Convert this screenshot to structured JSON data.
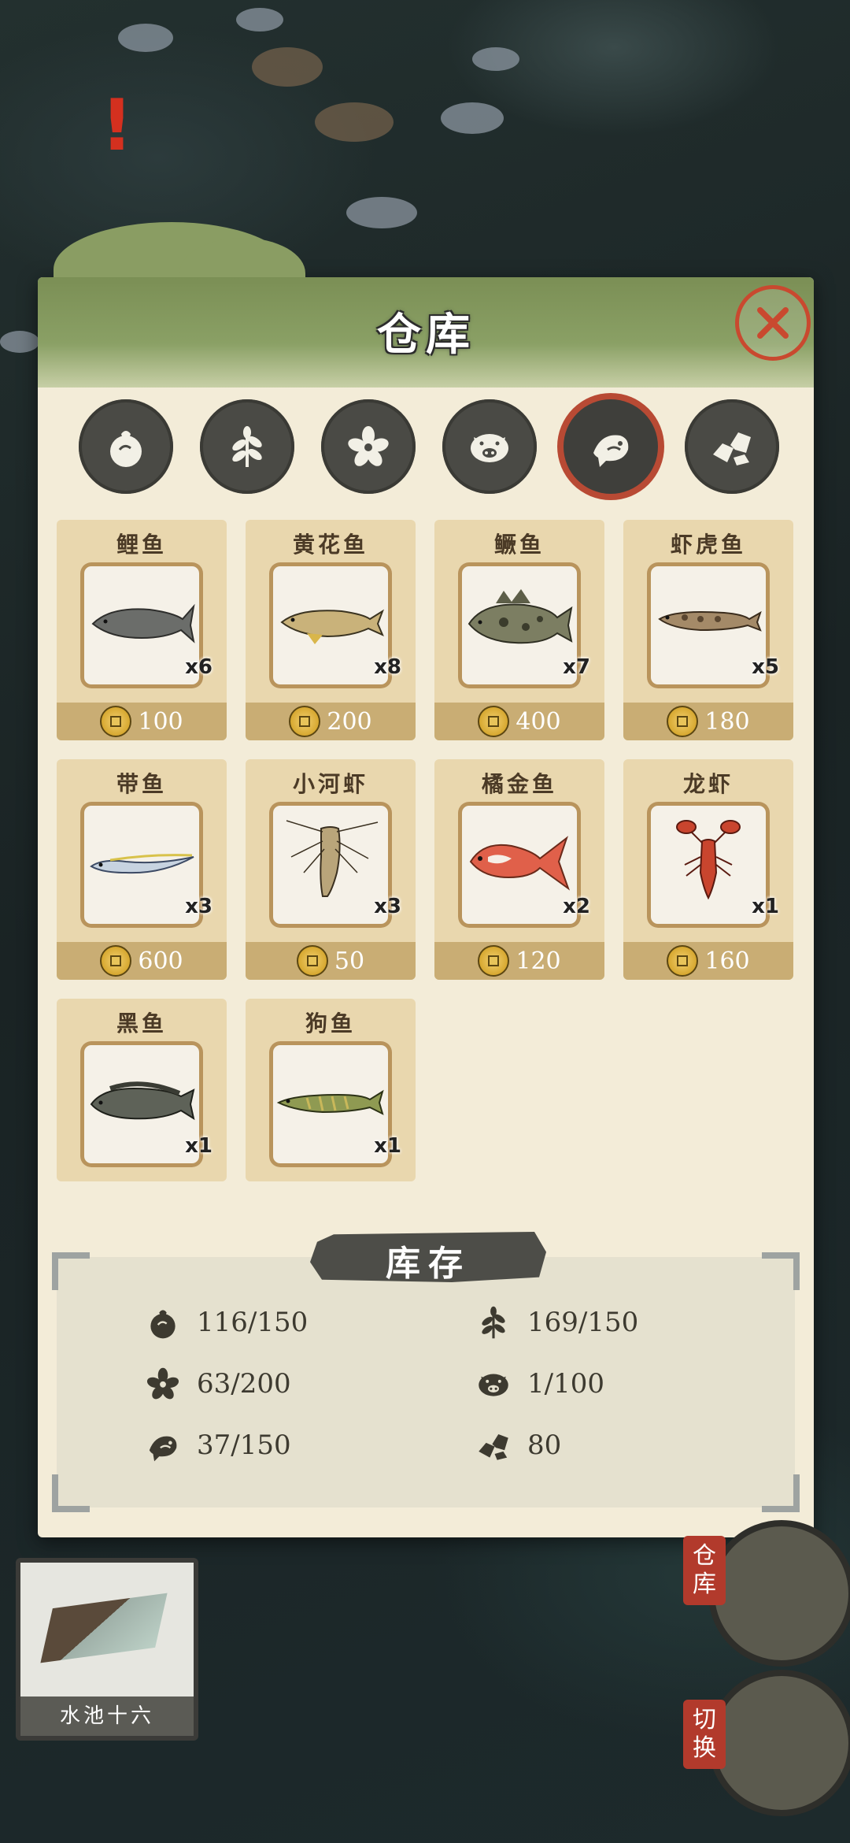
{
  "panel": {
    "title": "仓库"
  },
  "tabs": [
    {
      "icon": "vegetable-icon",
      "active": false
    },
    {
      "icon": "herb-icon",
      "active": false
    },
    {
      "icon": "flower-icon",
      "active": false
    },
    {
      "icon": "pig-icon",
      "active": false
    },
    {
      "icon": "fish-icon",
      "active": true
    },
    {
      "icon": "ore-icon",
      "active": false
    }
  ],
  "items": [
    {
      "name": "鲤鱼",
      "qty": "x6",
      "price": "100"
    },
    {
      "name": "黄花鱼",
      "qty": "x8",
      "price": "200"
    },
    {
      "name": "鳜鱼",
      "qty": "x7",
      "price": "400"
    },
    {
      "name": "虾虎鱼",
      "qty": "x5",
      "price": "180"
    },
    {
      "name": "带鱼",
      "qty": "x3",
      "price": "600"
    },
    {
      "name": "小河虾",
      "qty": "x3",
      "price": "50"
    },
    {
      "name": "橘金鱼",
      "qty": "x2",
      "price": "120"
    },
    {
      "name": "龙虾",
      "qty": "x1",
      "price": "160"
    },
    {
      "name": "黑鱼",
      "qty": "x1",
      "price": ""
    },
    {
      "name": "狗鱼",
      "qty": "x1",
      "price": ""
    }
  ],
  "inventory": {
    "title": "库存",
    "vegetable": "116/150",
    "herb": "169/150",
    "flower": "63/200",
    "pig": "1/100",
    "fish": "37/150",
    "ore": "80"
  },
  "bottom": {
    "pond_label": "水池十六",
    "warehouse_btn": "仓库",
    "switch_btn": "切换"
  },
  "colors": {
    "accent_red": "#b84a34",
    "panel_bg": "#f3ecd8",
    "header_green": "#8aa065"
  }
}
